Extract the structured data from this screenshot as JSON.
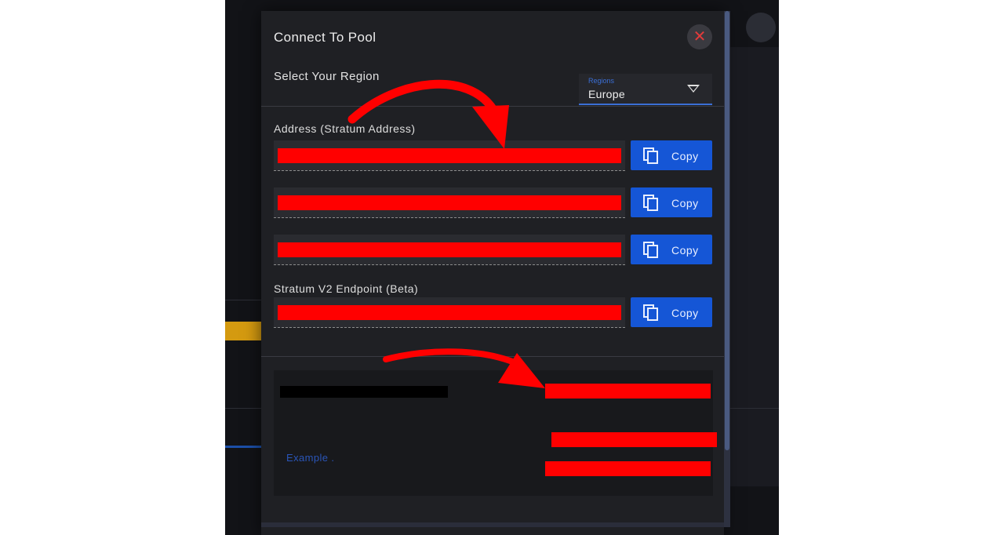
{
  "modal": {
    "title": "Connect To Pool",
    "close_icon": "close-icon",
    "region": {
      "label": "Select Your Region",
      "select_caption": "Regions",
      "selected": "Europe"
    },
    "address_section_label": "Address (Stratum Address)",
    "v2_section_label": "Stratum V2 Endpoint (Beta)",
    "copy_label": "Copy",
    "copy_icon": "copy-icon",
    "example_link": "Example ."
  },
  "colors": {
    "accent": "#1556d6",
    "redaction": "#ff0000",
    "close": "#e23b3b"
  }
}
